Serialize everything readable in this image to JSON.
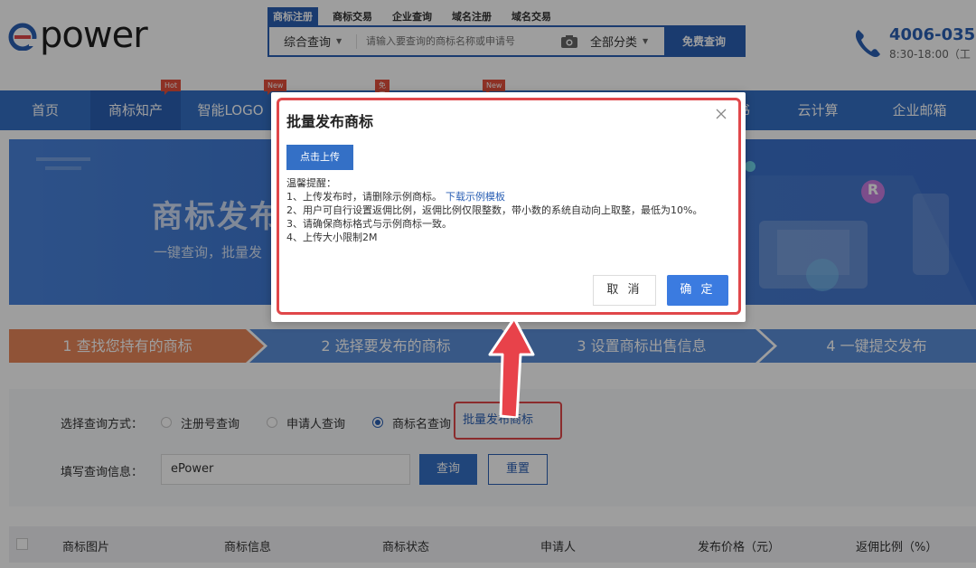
{
  "header": {
    "logo_text": "power",
    "search_tabs": [
      "商标注册",
      "商标交易",
      "企业查询",
      "域名注册",
      "域名交易"
    ],
    "search_type": "综合查询",
    "search_placeholder": "请输入要查询的商标名称或申请号",
    "category": "全部分类",
    "search_button": "免费查询",
    "phone_number": "4006-035-",
    "phone_hours": "8:30-18:00（工"
  },
  "nav": {
    "items": [
      {
        "label": "首页"
      },
      {
        "label": "商标知产",
        "badge": "Hot"
      },
      {
        "label": "智能LOGO",
        "badge": "New"
      },
      {
        "label": "",
        "badge": "免费"
      },
      {
        "label": "",
        "badge": "New"
      },
      {
        "label": "E书"
      },
      {
        "label": "云计算"
      },
      {
        "label": "企业邮箱"
      }
    ]
  },
  "banner": {
    "title": "商标发布",
    "subtitle": "一键查询，批量发",
    "badge": "R"
  },
  "steps": [
    {
      "label": "1 查找您持有的商标"
    },
    {
      "label": "2 选择要发布的商标"
    },
    {
      "label": "3 设置商标出售信息"
    },
    {
      "label": "4 一键提交发布"
    }
  ],
  "query": {
    "method_label": "选择查询方式：",
    "options": [
      "注册号查询",
      "申请人查询",
      "商标名查询"
    ],
    "selected_option": "商标名查询",
    "batch_link": "批量发布商标",
    "info_label": "填写查询信息：",
    "input_value": "ePower",
    "query_button": "查询",
    "reset_button": "重置"
  },
  "table": {
    "columns": [
      "商标图片",
      "商标信息",
      "商标状态",
      "申请人",
      "发布价格（元）",
      "返佣比例（%）"
    ]
  },
  "modal": {
    "title": "批量发布商标",
    "upload_button": "点击上传",
    "tips_heading": "温馨提醒：",
    "tip1": "1、上传发布时，请删除示例商标。",
    "tip1_link": "下载示例模板",
    "tip2": "2、用户可自行设置返佣比例，返佣比例仅限整数，带小数的系统自动向上取整，最低为10%。",
    "tip3": "3、请确保商标格式与示例商标一致。",
    "tip4": "4、上传大小限制2M",
    "cancel_button": "取 消",
    "confirm_button": "确 定"
  },
  "colors": {
    "brand_blue": "#2a5fb4",
    "nav_blue": "#3470c6",
    "highlight_red": "#e0474a",
    "step_active": "#e8875a",
    "step_inactive": "#5b8ed8"
  }
}
